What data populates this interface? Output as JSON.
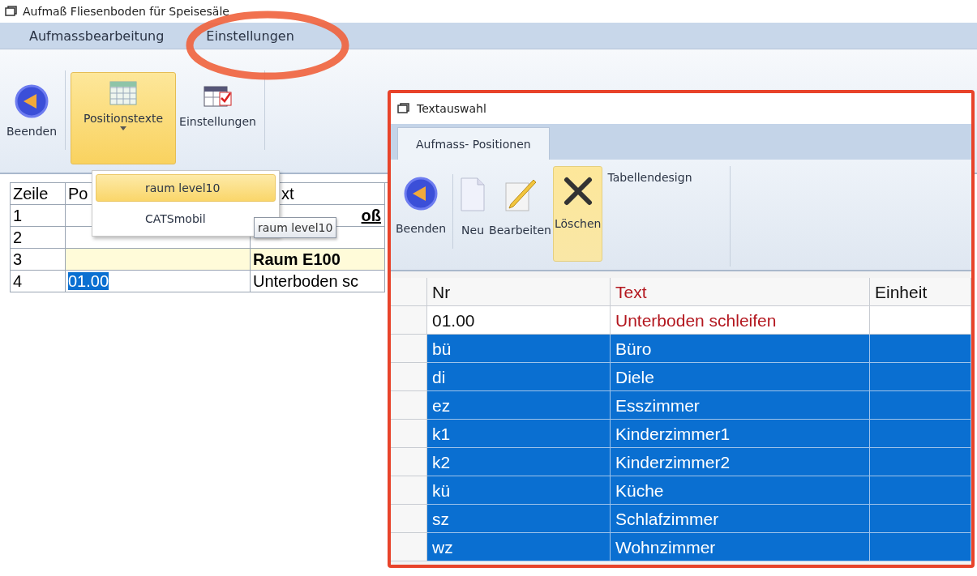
{
  "window": {
    "title": "Aufmaß Fliesenboden für Speisesäle"
  },
  "menu": [
    {
      "label": "Aufmassbearbeitung"
    },
    {
      "label": "Einstellungen"
    }
  ],
  "ribbon": [
    {
      "kind": "exit",
      "label": "Beenden",
      "highlighted": false
    },
    {
      "kind": "table",
      "label": "Positionstexte",
      "highlighted": true
    },
    {
      "kind": "settings",
      "label": "Einstellungen",
      "highlighted": false
    }
  ],
  "dropdown": {
    "items": [
      {
        "label": "raum level10",
        "selected": true
      },
      {
        "label": "CATSmobil",
        "selected": false
      }
    ],
    "tooltip": "raum level10"
  },
  "grid": {
    "columns": [
      "Zeile",
      "Po",
      "xt"
    ],
    "rows": [
      {
        "kind": "title",
        "cells": [
          "1",
          "",
          "oß"
        ],
        "highlighted": false
      },
      {
        "kind": "plain",
        "cells": [
          "2",
          "",
          ""
        ],
        "highlighted": false
      },
      {
        "kind": "room",
        "cells": [
          "3",
          "",
          "Raum E100"
        ],
        "highlighted": true
      },
      {
        "kind": "plain",
        "cells": [
          "4",
          "01.00",
          "Unterboden sc"
        ],
        "highlighted": false,
        "pos_selected": true
      }
    ]
  },
  "dialog": {
    "title": "Textauswahl",
    "tabs": [
      {
        "label": "Aufmass- Positionen",
        "selected": true
      }
    ],
    "buttons": [
      {
        "kind": "exit",
        "label": "Beenden",
        "highlighted": false
      },
      {
        "kind": "new",
        "label": "Neu",
        "highlighted": false
      },
      {
        "kind": "edit",
        "label": "Bearbeiten",
        "highlighted": false
      },
      {
        "kind": "delete",
        "label": "Löschen",
        "highlighted": true
      },
      {
        "kind": "text",
        "label": "Tabellendesign"
      }
    ],
    "table": {
      "columns": [
        {
          "label": "Nr",
          "accent": false
        },
        {
          "label": "Text",
          "accent": true
        },
        {
          "label": "Einheit",
          "accent": false
        }
      ],
      "rows": [
        {
          "cells": [
            "01.00",
            "Unterboden schleifen",
            ""
          ],
          "selected": false
        },
        {
          "cells": [
            "bü",
            "Büro",
            ""
          ],
          "selected": true
        },
        {
          "cells": [
            "di",
            "Diele",
            ""
          ],
          "selected": true
        },
        {
          "cells": [
            "ez",
            "Esszimmer",
            ""
          ],
          "selected": true
        },
        {
          "cells": [
            "k1",
            "Kinderzimmer1",
            ""
          ],
          "selected": true
        },
        {
          "cells": [
            "k2",
            "Kinderzimmer2",
            ""
          ],
          "selected": true
        },
        {
          "cells": [
            "kü",
            "Küche",
            ""
          ],
          "selected": true
        },
        {
          "cells": [
            "sz",
            "Schlafzimmer",
            ""
          ],
          "selected": true
        },
        {
          "cells": [
            "wz",
            "Wohnzimmer",
            ""
          ],
          "selected": true
        }
      ]
    }
  }
}
